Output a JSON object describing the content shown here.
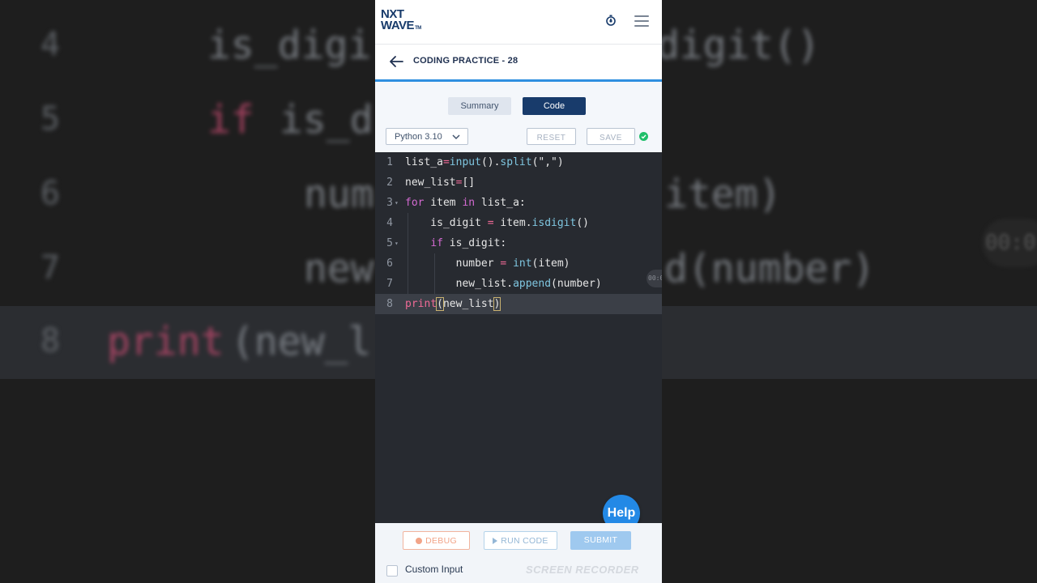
{
  "background": {
    "numbers": [
      "4",
      "5",
      "6",
      "7",
      "8"
    ],
    "fragments": [
      "is_digi",
      "digit()",
      "if",
      "is_d",
      "num",
      "item)",
      "new",
      "d(number)",
      "print",
      "(new_l"
    ],
    "timer": "00:0"
  },
  "header": {
    "logo_top": "NXT",
    "logo_bottom": "WAVE",
    "logo_tm": "TM"
  },
  "titlebar": {
    "title": "CODING PRACTICE - 28"
  },
  "tabs": [
    {
      "label": "Summary",
      "active": false
    },
    {
      "label": "Code",
      "active": true
    }
  ],
  "toolbar": {
    "language": "Python 3.10",
    "reset_label": "RESET",
    "save_label": "SAVE"
  },
  "editor": {
    "lines": [
      {
        "n": "1",
        "text": "list_a=input().split(\",\")"
      },
      {
        "n": "2",
        "text": "new_list=[]"
      },
      {
        "n": "3",
        "text": "for item in list_a:"
      },
      {
        "n": "4",
        "text": "    is_digit = item.isdigit()"
      },
      {
        "n": "5",
        "text": "    if is_digit:"
      },
      {
        "n": "6",
        "text": "        number = int(item)"
      },
      {
        "n": "7",
        "text": "        new_list.append(number)"
      },
      {
        "n": "8",
        "text": "print(new_list)"
      }
    ],
    "active_line": 8,
    "float_timer": "00:0"
  },
  "help": {
    "label": "Help"
  },
  "footer": {
    "debug_label": "DEBUG",
    "run_label": "RUN CODE",
    "submit_label": "SUBMIT",
    "custom_input_label": "Custom Input",
    "watermark": "SCREEN RECORDER"
  },
  "colors": {
    "brand": "#183b6b",
    "accent": "#2f8fe0",
    "help": "#2389e6",
    "editor_bg": "#272a30",
    "saved_green": "#1fbf6a"
  }
}
